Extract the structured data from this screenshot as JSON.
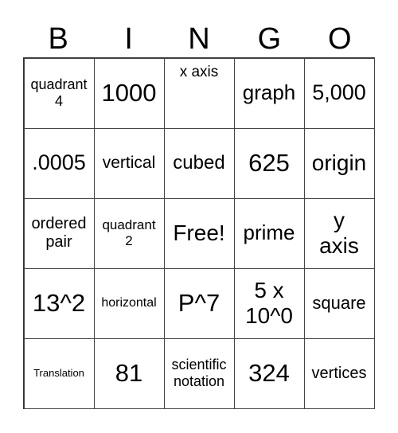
{
  "header": [
    "B",
    "I",
    "N",
    "G",
    "O"
  ],
  "cells": [
    "quadrant 4",
    "1000",
    "x axis",
    "graph",
    "5,000",
    ".0005",
    "vertical",
    "cubed",
    "625",
    "origin",
    "ordered pair",
    "quadrant 2",
    "Free!",
    "prime",
    "y axis",
    "13^2",
    "horizontal",
    "P^7",
    "5 x 10^0",
    "square",
    "Translation",
    "81",
    "scientific notation",
    "324",
    "vertices"
  ]
}
